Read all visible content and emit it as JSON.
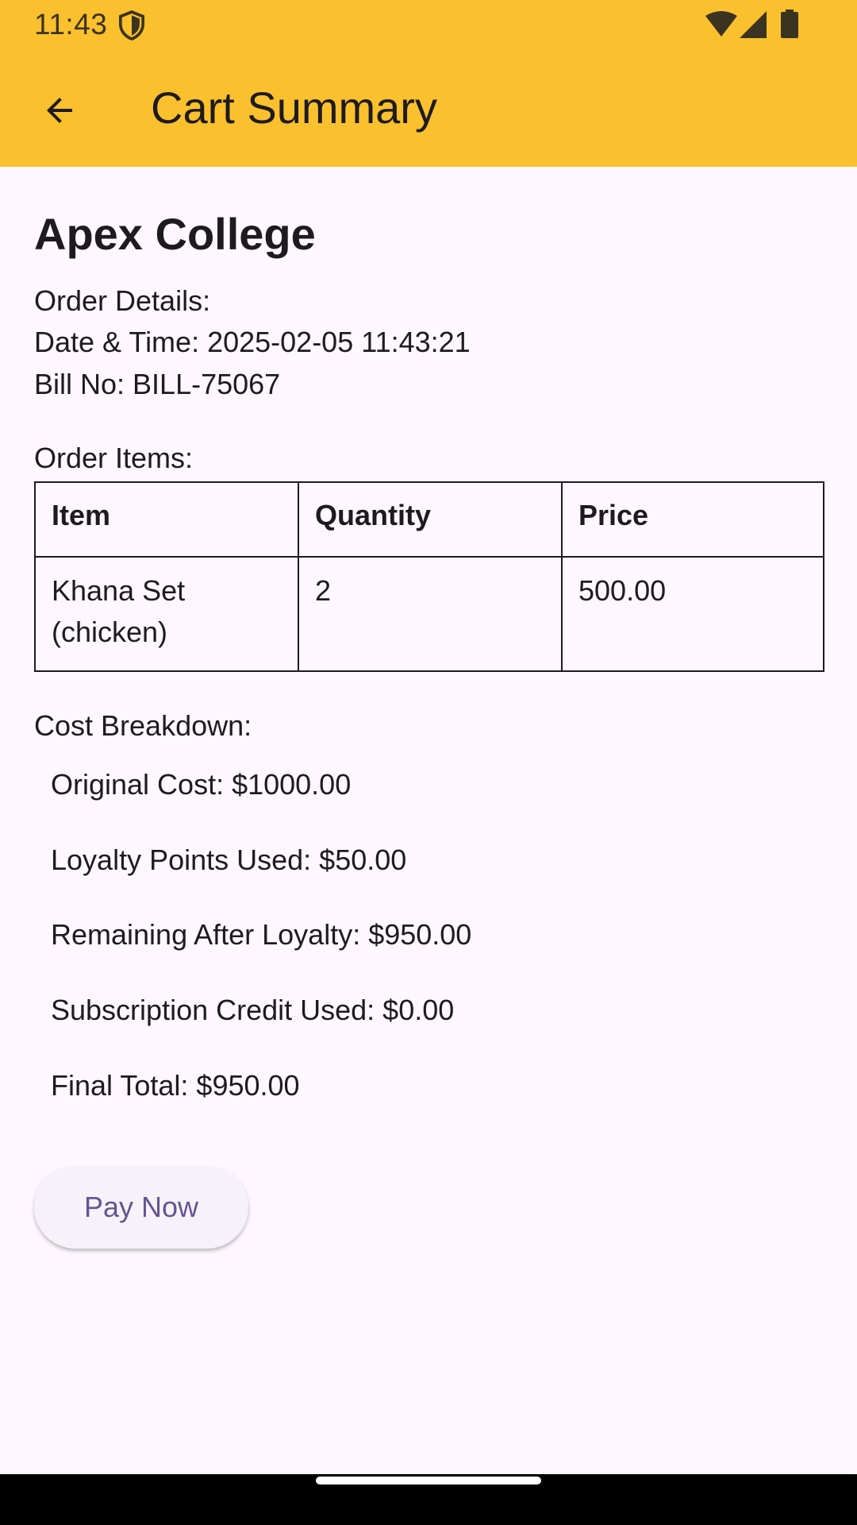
{
  "status_bar": {
    "time": "11:43",
    "icons": [
      "shield-icon",
      "wifi-icon",
      "cell-signal-icon",
      "battery-icon"
    ]
  },
  "app_bar": {
    "title": "Cart Summary",
    "back_icon": "arrow-back-icon",
    "color": "#fbc02d"
  },
  "order": {
    "college": "Apex College",
    "details_heading": "Order Details:",
    "date_time": "Date & Time: 2025-02-05 11:43:21",
    "bill_no": "Bill No: BILL-75067",
    "items_heading": "Order Items:"
  },
  "items_table": {
    "headers": [
      "Item",
      "Quantity",
      "Price"
    ],
    "rows": [
      [
        "Khana Set (chicken)",
        "2",
        "500.00"
      ]
    ]
  },
  "cost_breakdown": {
    "heading": "Cost Breakdown:",
    "original": "Original Cost: $1000.00",
    "loyalty": "Loyalty Points Used: $50.00",
    "remaining": "Remaining After Loyalty: $950.00",
    "subscription": "Subscription Credit Used: $0.00",
    "final": "Final Total: $950.00"
  },
  "pay_button": {
    "label": "Pay Now",
    "text_color": "#65558f"
  }
}
